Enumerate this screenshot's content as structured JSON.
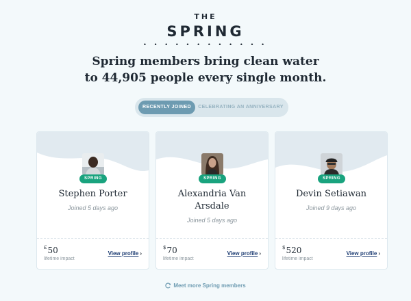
{
  "logo": {
    "line1": "THE",
    "line2": "SPRING",
    "dots": "• • • • • • • • • • • •"
  },
  "headline": {
    "line1": "Spring members bring clean water",
    "line2": "to 44,905 people every single month."
  },
  "tabs": [
    {
      "label": "RECENTLY JOINED",
      "active": true
    },
    {
      "label": "CELEBRATING AN ANNIVERSARY",
      "active": false
    }
  ],
  "members": [
    {
      "badge": "SPRING",
      "name": "Stephen Porter",
      "joined": "Joined 5 days ago",
      "currency": "£",
      "amount": "50",
      "amount_label": "lifetime impact",
      "link": "View profile",
      "avatar_icon": "person-photo"
    },
    {
      "badge": "SPRING",
      "name": "Alexandria Van Arsdale",
      "joined": "Joined 5 days ago",
      "currency": "$",
      "amount": "70",
      "amount_label": "lifetime impact",
      "link": "View profile",
      "avatar_icon": "person-photo"
    },
    {
      "badge": "SPRING",
      "name": "Devin Setiawan",
      "joined": "Joined 9 days ago",
      "currency": "$",
      "amount": "520",
      "amount_label": "lifetime impact",
      "link": "View profile",
      "avatar_icon": "person-photo"
    }
  ],
  "more_link": "Meet more Spring members",
  "colors": {
    "accent": "#6d9bb1",
    "badge": "#19a37e",
    "link": "#1e3d73",
    "card_wave": "#e1eaf0"
  }
}
